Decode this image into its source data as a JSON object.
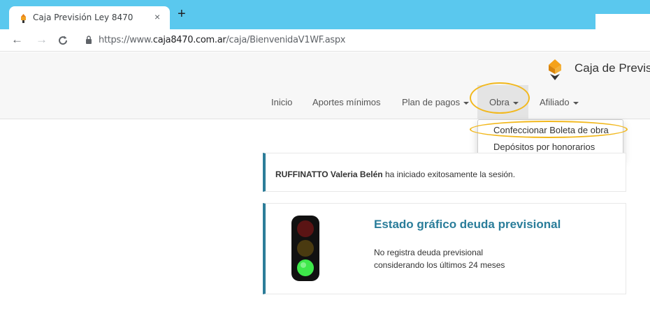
{
  "browser": {
    "tab_title": "Caja Previsión Ley 8470",
    "tab_close": "×",
    "new_tab": "+",
    "url_prefix": "https://www.",
    "url_domain": "caja8470.com.ar",
    "url_path": "/caja/BienvenidaV1WF.aspx",
    "back": "←",
    "forward": "→",
    "reload": "C"
  },
  "site": {
    "brand": "Caja de Previs",
    "menu": {
      "inicio": "Inicio",
      "aportes": "Aportes mínimos",
      "plan": "Plan de pagos",
      "obra": "Obra",
      "afiliado": "Afiliado"
    },
    "dropdown": {
      "item1": "Confeccionar Boleta de obra",
      "item2": "Depósitos por honorarios"
    }
  },
  "welcome": {
    "user": "RUFFINATTO Valeria Belén",
    "message": "ha iniciado exitosamente la sesión."
  },
  "estado": {
    "title": "Estado gráfico deuda previsional",
    "line1": "No registra deuda previsional",
    "line2": "considerando los últimos 24 meses"
  },
  "colors": {
    "tabstrip": "#5ac8ee",
    "accent": "#2c7d99",
    "highlight": "#f2b81d",
    "light_green": "#3ee84a"
  }
}
